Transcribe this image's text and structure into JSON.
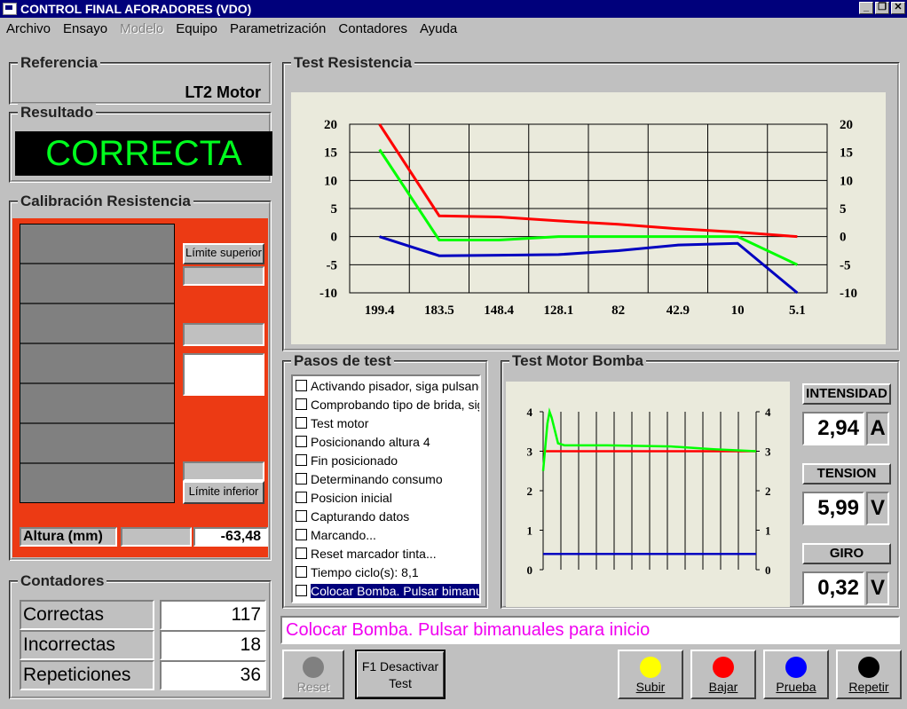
{
  "window": {
    "title": "CONTROL FINAL AFORADORES (VDO)"
  },
  "menu": [
    {
      "label": "Archivo",
      "disabled": false
    },
    {
      "label": "Ensayo",
      "disabled": false
    },
    {
      "label": "Modelo",
      "disabled": true
    },
    {
      "label": "Equipo",
      "disabled": false
    },
    {
      "label": "Parametrización",
      "disabled": false
    },
    {
      "label": "Contadores",
      "disabled": false
    },
    {
      "label": "Ayuda",
      "disabled": false
    }
  ],
  "referencia": {
    "title": "Referencia",
    "value": "LT2 Motor"
  },
  "resultado": {
    "title": "Resultado",
    "value": "CORRECTA",
    "color": "#00ff1e"
  },
  "calibracion": {
    "title": "Calibración Resistencia",
    "limite_superior": "Límite superior",
    "limite_inferior": "Límite inferior",
    "altura_label": "Altura (mm)",
    "altura_value": "-63,48"
  },
  "contadores": {
    "title": "Contadores",
    "rows": [
      {
        "label": "Correctas",
        "value": "117"
      },
      {
        "label": "Incorrectas",
        "value": "18"
      },
      {
        "label": "Repeticiones",
        "value": "36"
      }
    ]
  },
  "test_resistencia": {
    "title": "Test  Resistencia"
  },
  "pasos": {
    "title": "Pasos de test",
    "items": [
      "Activando pisador, siga pulsand",
      "Comprobando tipo de brida, siga",
      "Test motor",
      "Posicionando altura 4",
      "Fin posicionado",
      "Determinando consumo",
      "Posicion inicial",
      "Capturando datos",
      "Marcando...",
      "Reset marcador tinta...",
      "Tiempo ciclo(s): 8,1",
      "Colocar Bomba. Pulsar bimanua"
    ],
    "selected_index": 11
  },
  "motor": {
    "title": "Test Motor Bomba",
    "intensidad": {
      "label": "INTENSIDAD",
      "value": "2,94",
      "unit": "A"
    },
    "tension": {
      "label": "TENSION",
      "value": "5,99",
      "unit": "V"
    },
    "giro": {
      "label": "GIRO",
      "value": "0,32",
      "unit": "V"
    }
  },
  "status_message": "Colocar Bomba. Pulsar bimanuales para inicio",
  "buttons": {
    "reset": {
      "label": "Reset",
      "color": "#808080",
      "disabled": true
    },
    "f1": {
      "line1": "F1 Desactivar",
      "line2": "Test"
    },
    "subir": {
      "label": "Subir",
      "color": "#ffff00"
    },
    "bajar": {
      "label": "Bajar",
      "color": "#ff0000"
    },
    "prueba": {
      "label": "Prueba",
      "color": "#0000ff"
    },
    "repetir": {
      "label": "Repetir",
      "color": "#000000"
    }
  },
  "chart_data": [
    {
      "type": "line",
      "categories": [
        "199.4",
        "183.5",
        "148.4",
        "128.1",
        "82",
        "42.9",
        "10",
        "5.1"
      ],
      "ylim": [
        -10,
        20
      ],
      "yticks": [
        20,
        15,
        10,
        5,
        0,
        -5,
        -10
      ],
      "grid": true,
      "series": [
        {
          "color": "#ff0000",
          "values": [
            20,
            3.7,
            3.5,
            2.8,
            2.2,
            1.4,
            0.8,
            0
          ]
        },
        {
          "color": "#00ff00",
          "values": [
            15.5,
            -0.6,
            -0.6,
            0,
            0,
            0,
            0,
            -5
          ]
        },
        {
          "color": "#0000c0",
          "values": [
            0,
            -3.4,
            -3.3,
            -3.2,
            -2.5,
            -1.5,
            -1.2,
            -10
          ]
        }
      ]
    },
    {
      "type": "line",
      "ylim": [
        0,
        4
      ],
      "yticks": [
        4,
        3,
        2,
        1,
        0
      ],
      "grid": true,
      "series": [
        {
          "color": "#ff0000",
          "x": [
            0,
            100
          ],
          "values": [
            3,
            3
          ]
        },
        {
          "color": "#00ff00",
          "x": [
            0,
            2,
            3,
            4,
            7,
            10,
            30,
            60,
            80,
            100
          ],
          "values": [
            2.5,
            3.7,
            4,
            3.85,
            3.2,
            3.15,
            3.15,
            3.12,
            3.05,
            3
          ]
        },
        {
          "color": "#0000c0",
          "x": [
            0,
            100
          ],
          "values": [
            0.4,
            0.4
          ]
        }
      ]
    }
  ]
}
